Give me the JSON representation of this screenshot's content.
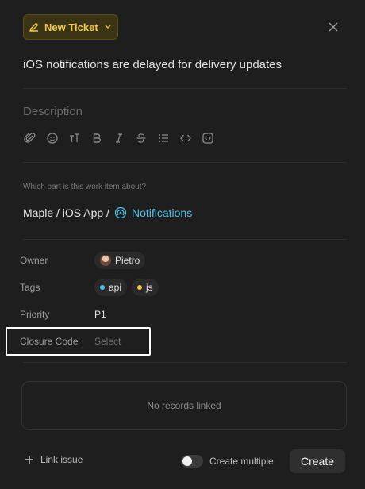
{
  "header": {
    "badge_label": "New Ticket",
    "badge_icon": "pencil-icon",
    "close_icon": "close-icon"
  },
  "ticket": {
    "title": "iOS notifications are delayed for delivery updates",
    "description_placeholder": "Description"
  },
  "toolbar": {
    "icons": [
      "attach-icon",
      "emoji-icon",
      "text-size-icon",
      "bold-icon",
      "italic-icon",
      "strikethrough-icon",
      "list-icon",
      "code-icon",
      "code-block-icon"
    ]
  },
  "work_item": {
    "hint": "Which part is this work item about?",
    "path_prefix": "Maple / iOS App /",
    "node_label": "Notifications",
    "accent": "#4fc1e8"
  },
  "fields": {
    "owner": {
      "label": "Owner",
      "value": "Pietro"
    },
    "tags": {
      "label": "Tags",
      "items": [
        {
          "name": "api",
          "color": "#4fc1e8"
        },
        {
          "name": "js",
          "color": "#f2c94c"
        }
      ]
    },
    "priority": {
      "label": "Priority",
      "value": "P1"
    },
    "closure_code": {
      "label": "Closure Code",
      "placeholder": "Select"
    }
  },
  "records": {
    "empty_text": "No records linked"
  },
  "footer": {
    "link_issue": "Link issue",
    "create_multiple": "Create multiple",
    "create_multiple_on": false,
    "create_button": "Create"
  }
}
